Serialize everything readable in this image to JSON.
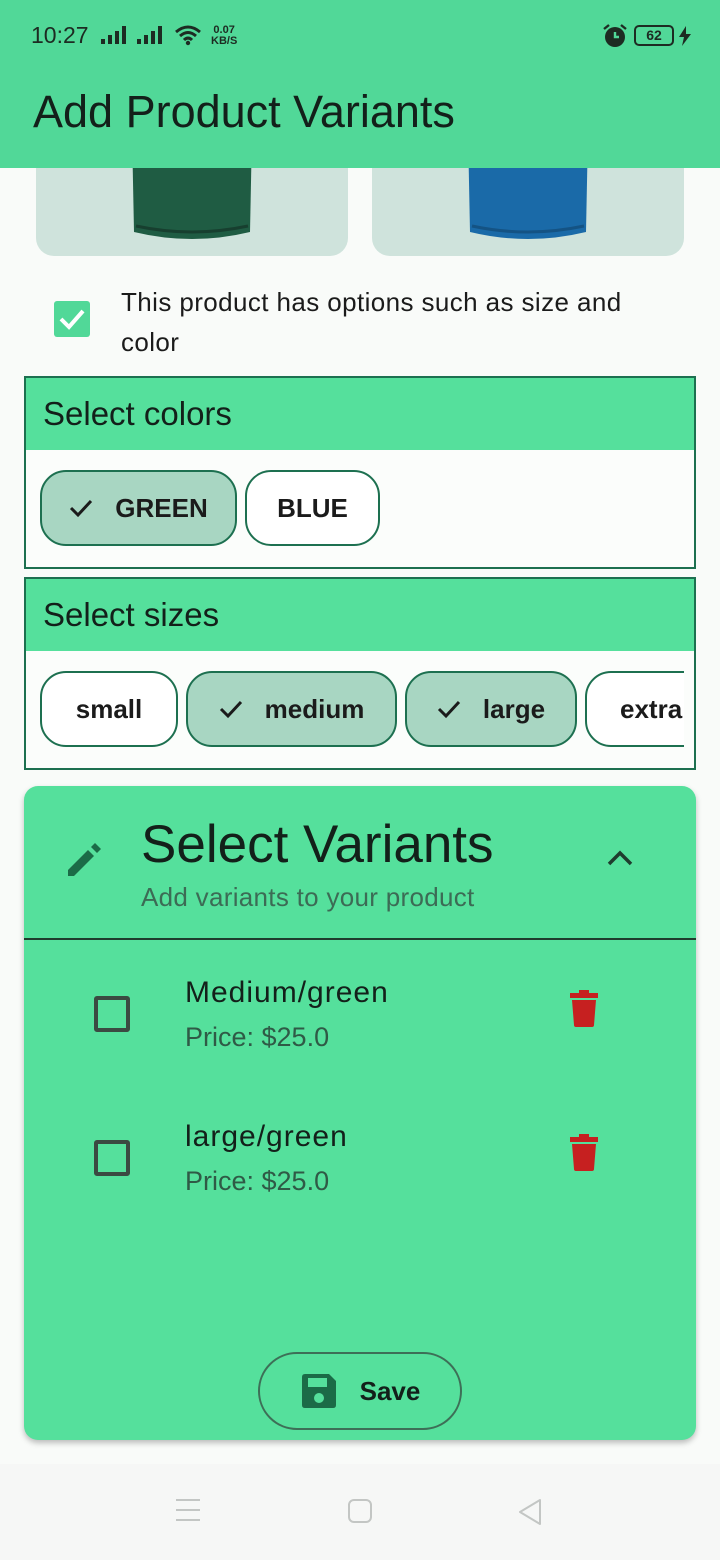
{
  "status_bar": {
    "time": "10:27",
    "speed_value": "0.07",
    "speed_unit": "KB/S",
    "battery": "62",
    "icons": [
      "signal-icon",
      "signal-icon",
      "wifi-icon",
      "alarm-icon",
      "battery-icon",
      "charging-icon"
    ]
  },
  "appbar": {
    "title": "Add Product Variants"
  },
  "product_images": [
    {
      "name": "green-tshirt-image",
      "color": "#1f5c43"
    },
    {
      "name": "blue-tshirt-image",
      "color": "#1a6aa8"
    }
  ],
  "options": {
    "checked": true,
    "text": "This product has options such as size and color"
  },
  "colors": {
    "heading": "Select colors",
    "chips": [
      {
        "label": "GREEN",
        "selected": true
      },
      {
        "label": "BLUE",
        "selected": false
      }
    ]
  },
  "sizes": {
    "heading": "Select sizes",
    "chips": [
      {
        "label": "small",
        "selected": false
      },
      {
        "label": "medium",
        "selected": true
      },
      {
        "label": "large",
        "selected": true
      },
      {
        "label": "extra",
        "selected": false
      }
    ]
  },
  "variants": {
    "title": "Select Variants",
    "subtitle": "Add variants to your product",
    "items": [
      {
        "name": "Medium/green",
        "price": "Price: $25.0",
        "checked": false
      },
      {
        "name": "large/green",
        "price": "Price: $25.0",
        "checked": false
      }
    ],
    "save_label": "Save"
  },
  "theme": {
    "primary": "#51d898",
    "dark_green": "#1d7050",
    "chip_selected": "#a8d6c2",
    "delete_red": "#c62020"
  }
}
